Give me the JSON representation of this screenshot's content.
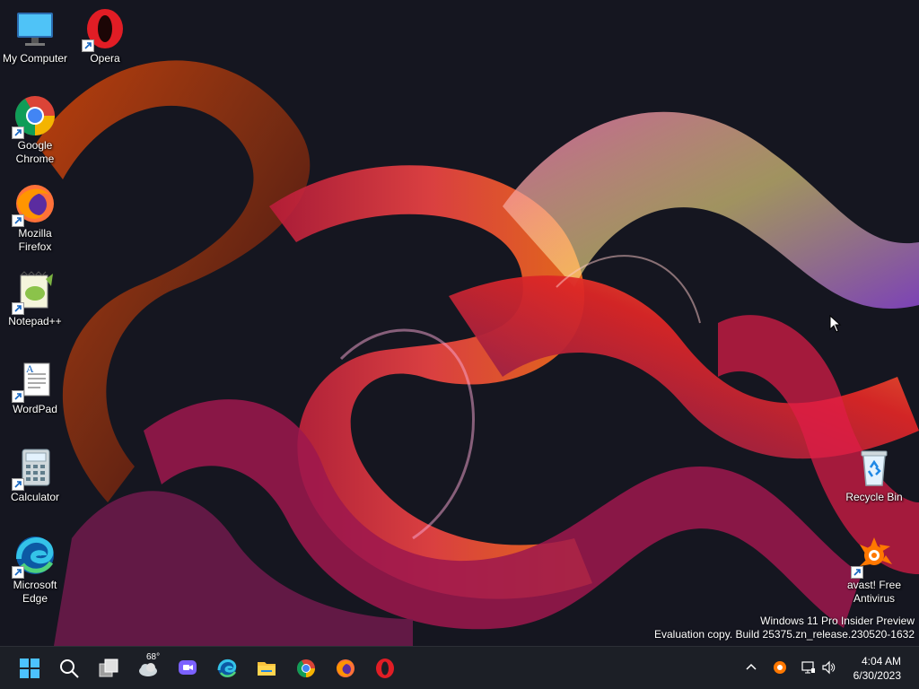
{
  "desktop": {
    "icons_left": [
      {
        "label": "My Computer",
        "icon": "monitor-icon"
      },
      {
        "label": "Opera",
        "icon": "opera-icon"
      },
      {
        "label": "Google\nChrome",
        "icon": "chrome-icon"
      },
      {
        "label": "Mozilla\nFirefox",
        "icon": "firefox-icon"
      },
      {
        "label": "Notepad++",
        "icon": "notepadpp-icon"
      },
      {
        "label": "WordPad",
        "icon": "wordpad-icon"
      },
      {
        "label": "Calculator",
        "icon": "calculator-icon"
      },
      {
        "label": "Microsoft\nEdge",
        "icon": "edge-icon"
      }
    ],
    "icons_right": [
      {
        "label": "Recycle Bin",
        "icon": "recycle-bin-icon"
      },
      {
        "label": "avast! Free\nAntivirus",
        "icon": "avast-icon"
      }
    ],
    "watermark_line1": "Windows 11 Pro Insider Preview",
    "watermark_line2": "Evaluation copy. Build 25375.zn_release.230520-1632"
  },
  "taskbar": {
    "apps": [
      "start-icon",
      "search-icon",
      "task-view-icon",
      "weather-icon",
      "teams-chat-icon",
      "edge-icon",
      "file-explorer-icon",
      "chrome-icon",
      "firefox-icon",
      "opera-icon"
    ],
    "weather_temp": "68°",
    "tray": [
      "chevron-up-icon",
      "avast-tray-icon",
      "network-icon",
      "volume-icon"
    ],
    "time": "4:04 AM",
    "date": "6/30/2023"
  },
  "colors": {
    "taskbar_bg": "#1c1f26",
    "desktop_bg": "#12131a",
    "accent": "#0078d4"
  }
}
